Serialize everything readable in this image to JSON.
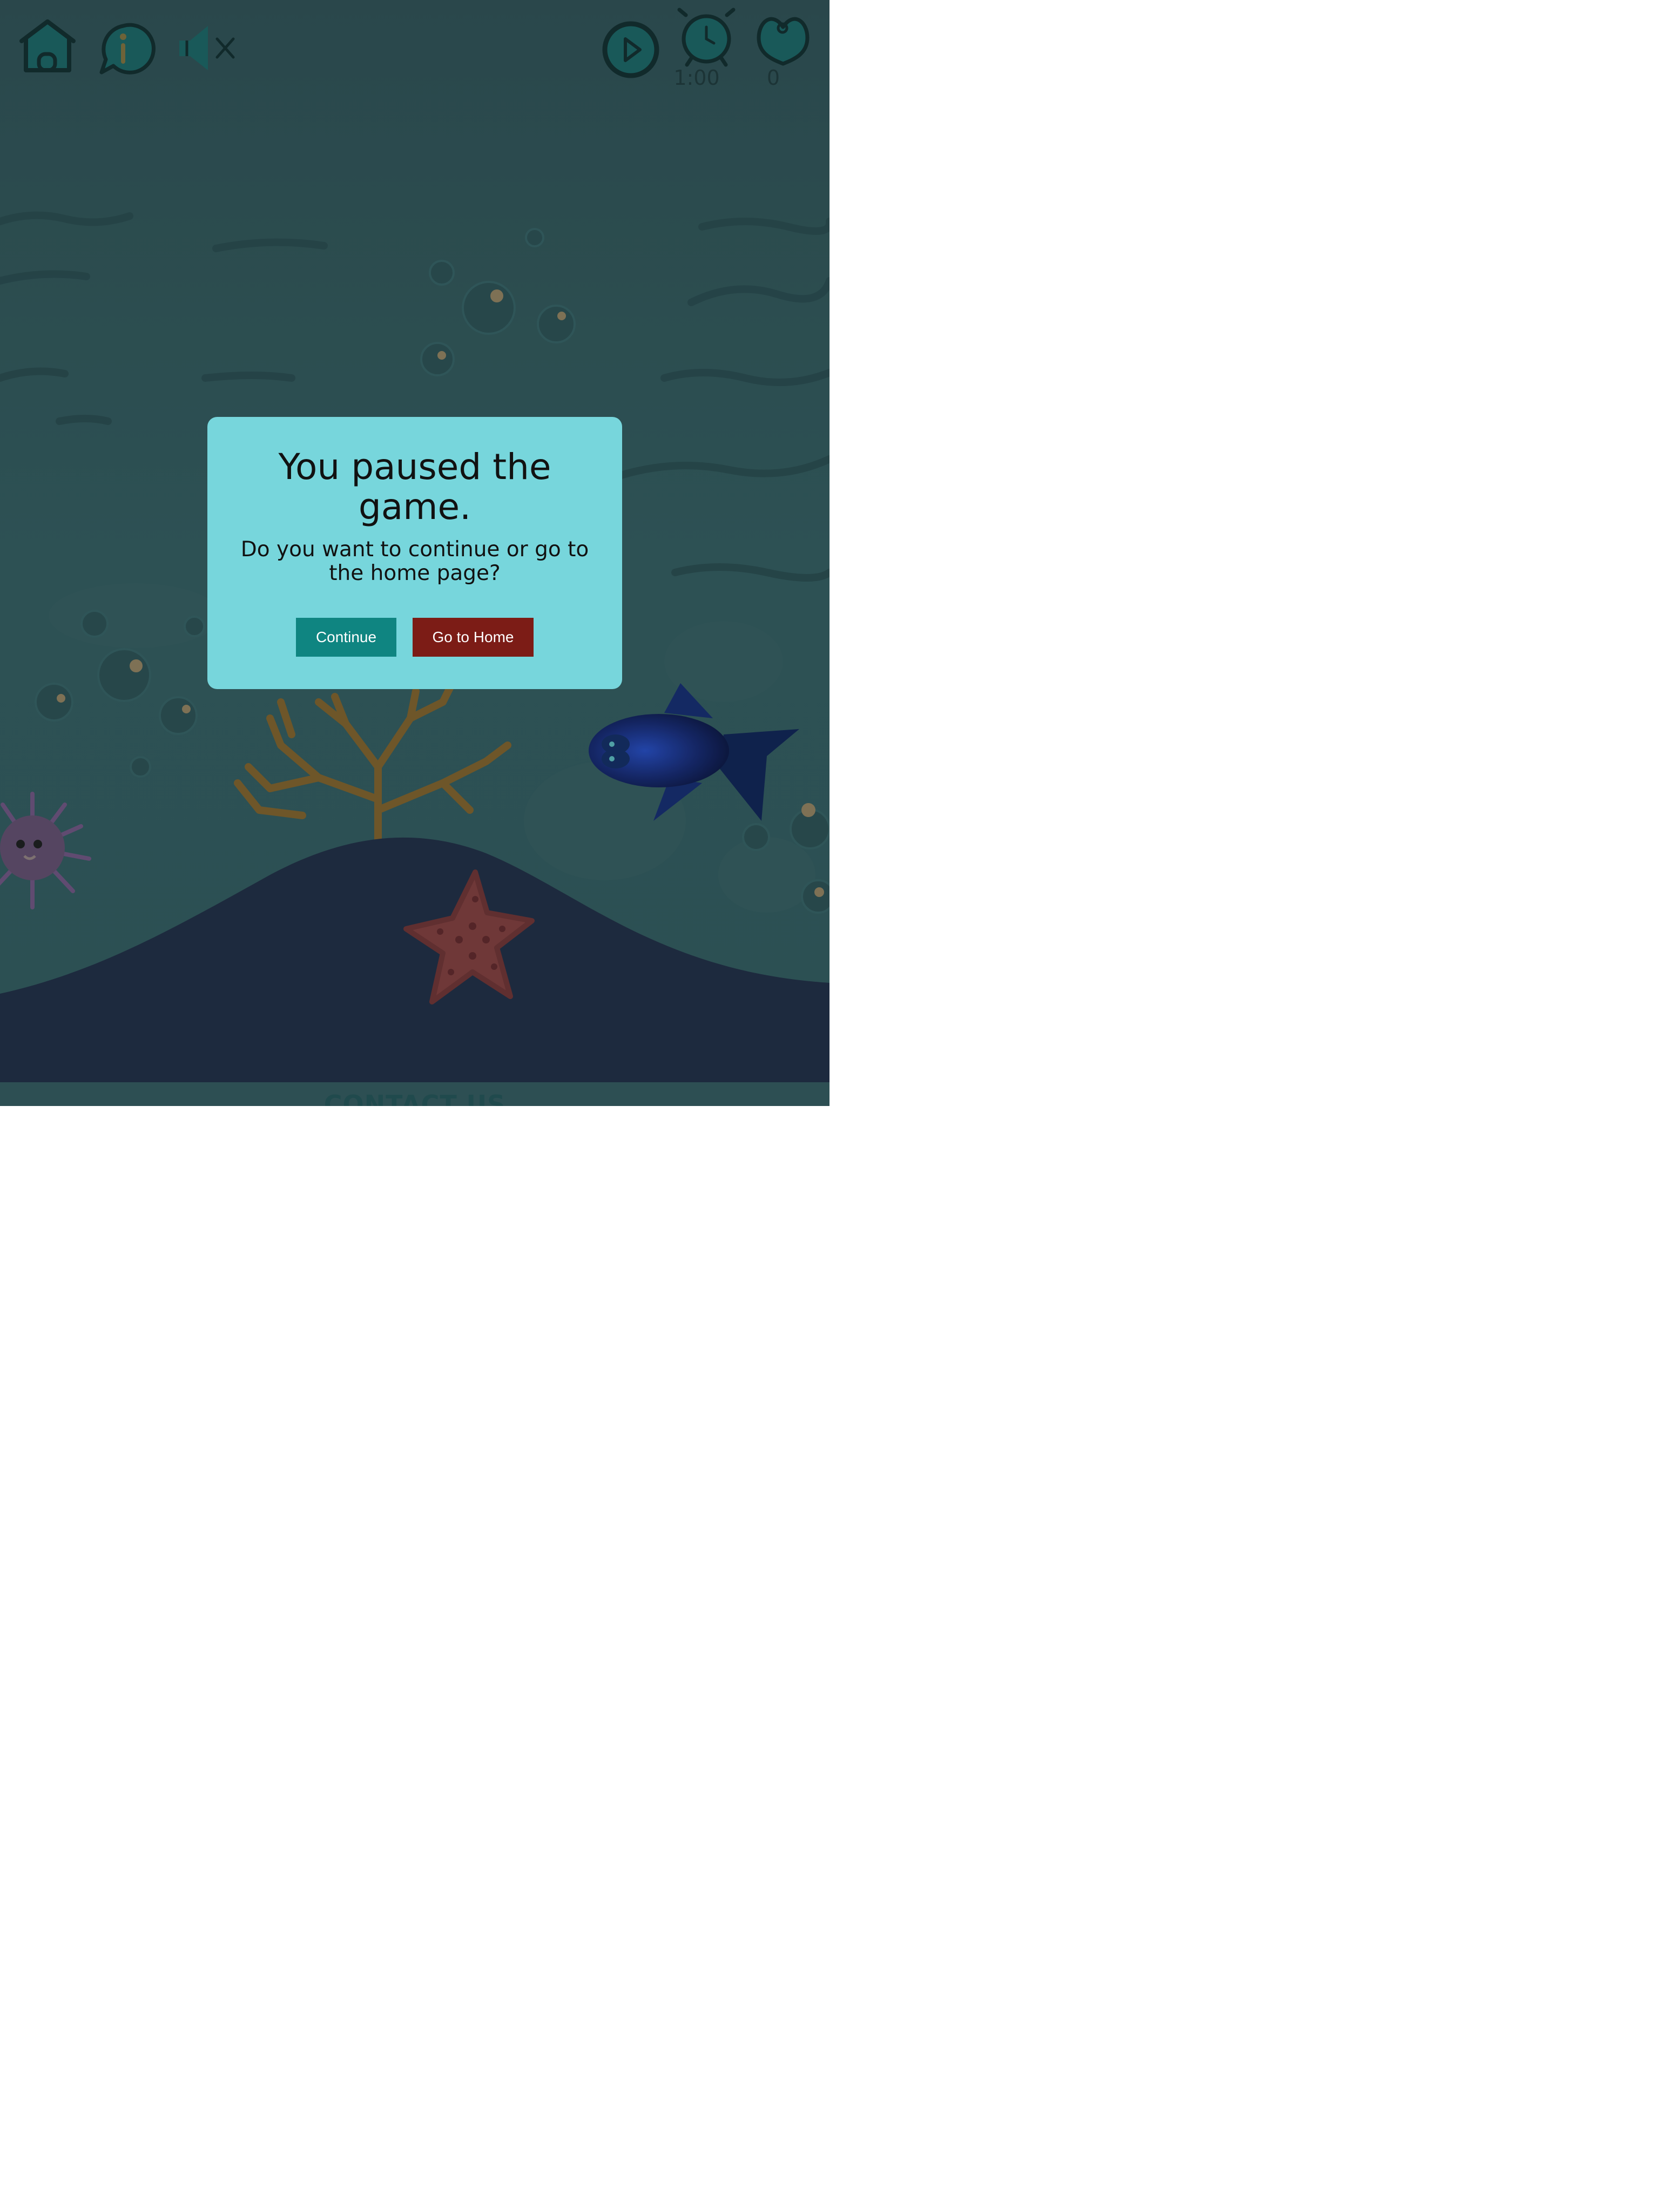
{
  "hud": {
    "home_icon": "home-icon",
    "info_icon": "info-icon",
    "sound_icon": "speaker-muted-icon",
    "play_icon": "play-icon",
    "timer_icon": "alarm-clock-icon",
    "timer_value": "1:00",
    "score_icon": "heart-icon",
    "score_value": "0"
  },
  "pause_dialog": {
    "title": "You paused the game.",
    "message": "Do you want to continue or go to the home page?",
    "continue_label": "Continue",
    "home_label": "Go to Home"
  },
  "footer": {
    "contact_label": "CONTACT US"
  },
  "colors": {
    "water": "#2f5457",
    "seabed": "#1e2a40",
    "dialog_bg": "#77d6dc",
    "continue_button": "#0f8581",
    "home_button": "#7c1c16"
  }
}
